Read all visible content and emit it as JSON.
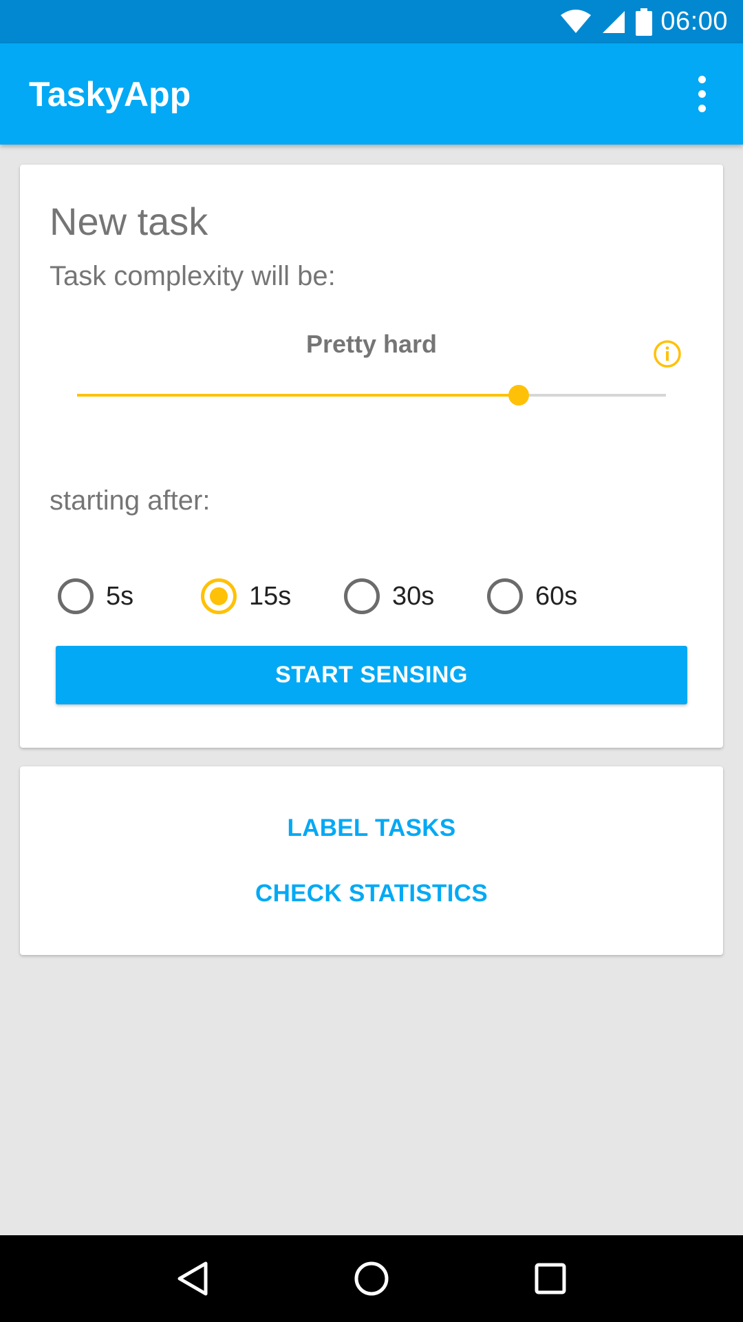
{
  "status_bar": {
    "time": "06:00"
  },
  "app_bar": {
    "title": "TaskyApp"
  },
  "task_card": {
    "title": "New task",
    "complexity_label": "Task complexity will be:",
    "complexity_value": "Pretty hard",
    "slider": {
      "value": 0.75
    },
    "starting_label": "starting after:",
    "delays": [
      {
        "label": "5s",
        "checked": false
      },
      {
        "label": "15s",
        "checked": true
      },
      {
        "label": "30s",
        "checked": false
      },
      {
        "label": "60s",
        "checked": false
      }
    ],
    "start_button": "START SENSING"
  },
  "actions_card": {
    "label_tasks": "LABEL TASKS",
    "check_statistics": "CHECK STATISTICS"
  },
  "colors": {
    "primary": "#03a9f4",
    "primary_dark": "#0288d1",
    "accent": "#ffc107"
  },
  "icons": {
    "status": [
      "wifi-icon",
      "cell-signal-icon",
      "battery-icon"
    ],
    "info": "info-icon",
    "overflow": "overflow-menu-icon",
    "nav": [
      "back-icon",
      "home-icon",
      "recents-icon"
    ]
  }
}
